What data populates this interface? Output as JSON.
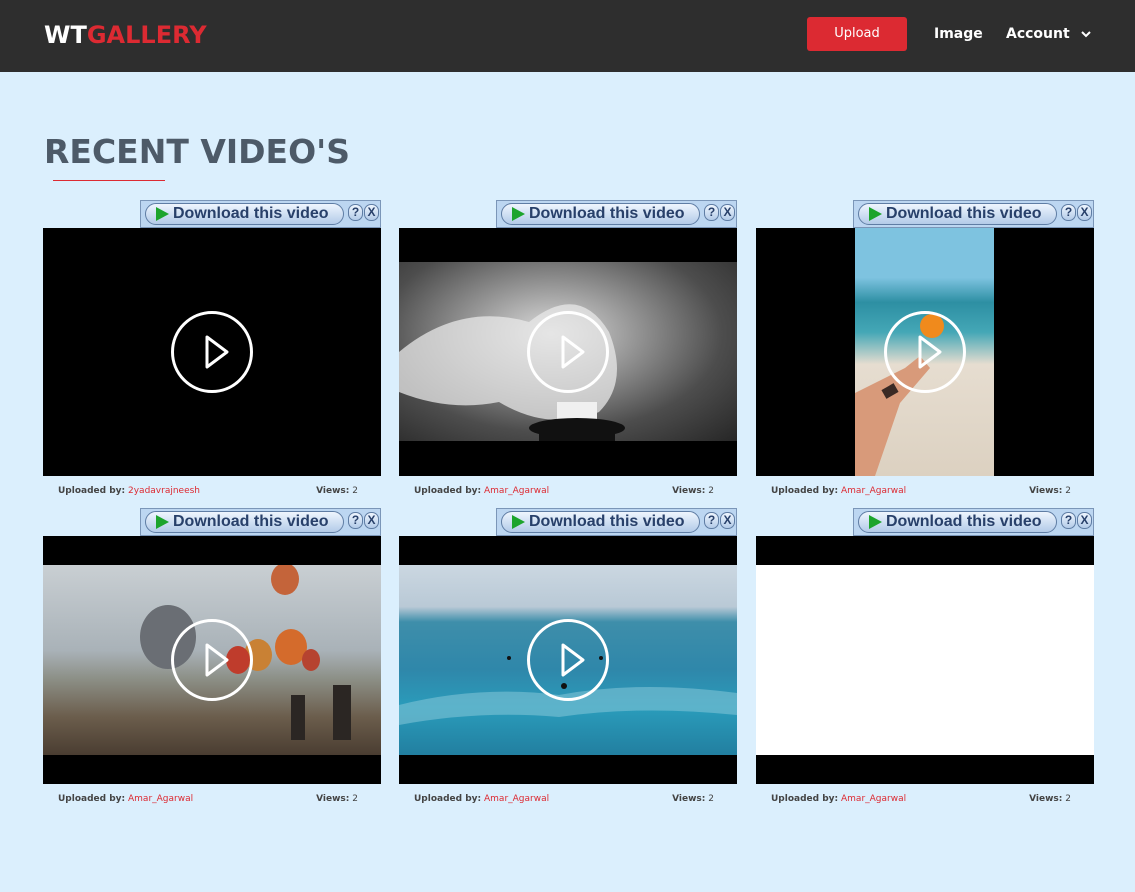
{
  "nav": {
    "logo_part1": "WT",
    "logo_part2": "GALLERY",
    "upload_label": "Upload",
    "image_label": "Image",
    "account_label": "Account",
    "brand_color": "#dc2a32"
  },
  "page": {
    "title": "RECENT VIDEO'S"
  },
  "download_bar": {
    "label": "Download this video",
    "help": "?",
    "close": "X"
  },
  "meta_labels": {
    "uploaded_by": "Uploaded by:",
    "views": "Views:"
  },
  "videos": [
    {
      "uploader": "2yadavrajneesh",
      "views": "2",
      "thumbnail": "black"
    },
    {
      "uploader": "Amar_Agarwal",
      "views": "2",
      "thumbnail": "black-and-white statue with flowing fabric"
    },
    {
      "uploader": "Amar_Agarwal",
      "views": "2",
      "thumbnail": "hand holding orange on beach"
    },
    {
      "uploader": "Amar_Agarwal",
      "views": "2",
      "thumbnail": "hot air balloons over valley"
    },
    {
      "uploader": "Amar_Agarwal",
      "views": "2",
      "thumbnail": "ocean waves with surfers"
    },
    {
      "uploader": "Amar_Agarwal",
      "views": "2",
      "thumbnail": "white"
    }
  ]
}
